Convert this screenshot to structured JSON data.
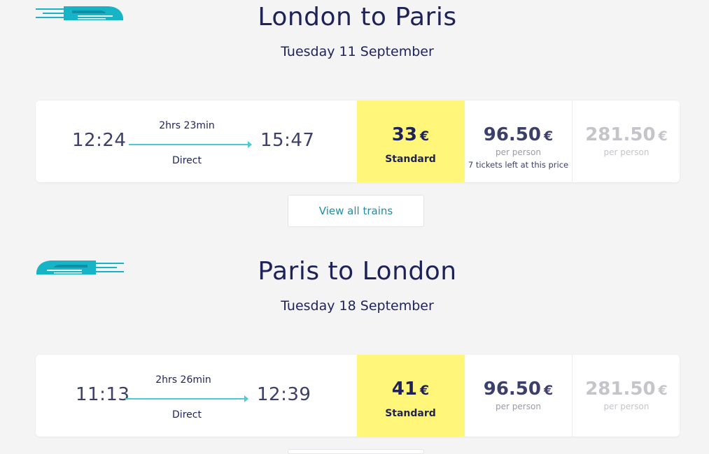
{
  "colors": {
    "accent": "#4ec9d6",
    "selected_fare_bg": "#fff67a",
    "title": "#1e2258",
    "link": "#1c8ea6"
  },
  "outbound": {
    "logo_icon": "train-icon",
    "title": "London to Paris",
    "date": "Tuesday 11 September",
    "journey": {
      "depart": "12:24",
      "arrive": "15:47",
      "duration": "2hrs 23min",
      "changes": "Direct"
    },
    "fares": [
      {
        "amount": "33",
        "currency": "€",
        "class": "Standard"
      },
      {
        "amount": "96.50",
        "currency": "€",
        "per": "per person",
        "note": "7 tickets left at this price"
      },
      {
        "amount": "281.50",
        "currency": "€",
        "per": "per person"
      }
    ],
    "view_all": "View all trains"
  },
  "inbound": {
    "logo_icon": "train-icon",
    "title": "Paris to London",
    "date": "Tuesday 18 September",
    "journey": {
      "depart": "11:13",
      "arrive": "12:39",
      "duration": "2hrs 26min",
      "changes": "Direct"
    },
    "fares": [
      {
        "amount": "41",
        "currency": "€",
        "class": "Standard"
      },
      {
        "amount": "96.50",
        "currency": "€",
        "per": "per person"
      },
      {
        "amount": "281.50",
        "currency": "€",
        "per": "per person"
      }
    ]
  }
}
